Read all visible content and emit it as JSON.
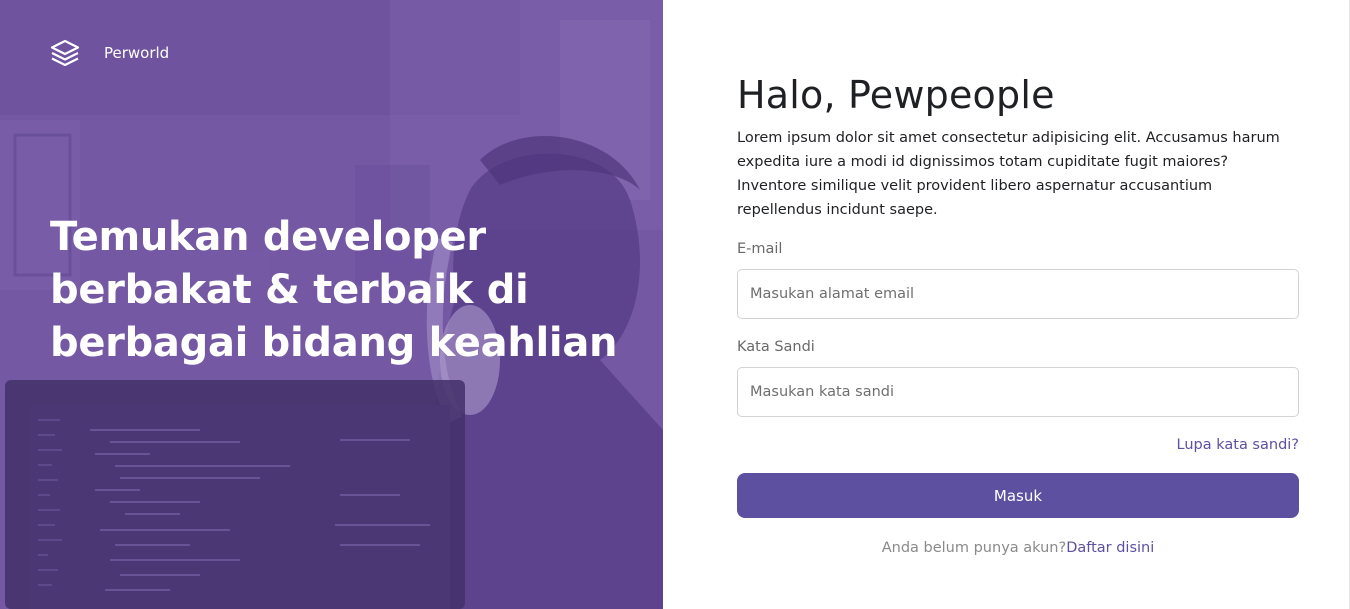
{
  "brand": {
    "name": "Perworld",
    "icon": "layers-icon"
  },
  "hero": {
    "headline": "Temukan developer berbakat & terbaik di berbagai bidang keahlian",
    "overlay_color": "#6a4e9c"
  },
  "login": {
    "title": "Halo, Pewpeople",
    "description": "Lorem ipsum dolor sit amet consectetur adipisicing elit. Accusamus harum expedita iure a modi id dignissimos totam cupiditate fugit maiores? Inventore similique velit provident libero aspernatur accusantium repellendus incidunt saepe.",
    "email_label": "E-mail",
    "email_placeholder": "Masukan alamat email",
    "password_label": "Kata Sandi",
    "password_placeholder": "Masukan kata sandi",
    "forgot_link": "Lupa kata sandi?",
    "submit_label": "Masuk",
    "signup_prompt": "Anda belum punya akun?",
    "signup_link": "Daftar disini"
  },
  "colors": {
    "accent": "#5e50a1",
    "hero_purple": "#6a4e9c"
  }
}
